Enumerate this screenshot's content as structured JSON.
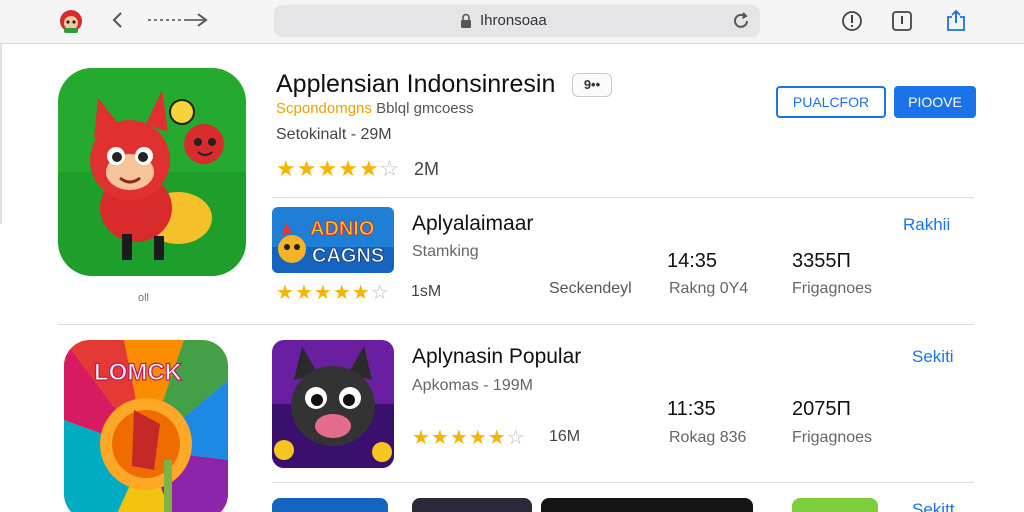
{
  "toolbar": {
    "url": "Ihronsoaa",
    "logo_icon": "mascot-logo-icon",
    "back_icon": "chevron-left-icon",
    "forward_icon": "arrow-right-icon",
    "lock_icon": "lock-icon",
    "reload_icon": "reload-icon",
    "right_icons": [
      "info-icon",
      "bookmark-icon",
      "share-icon"
    ]
  },
  "featured": {
    "title": "Applensian Indonsinresin",
    "more_label": "9••",
    "developer_brand": "Scpondomgns",
    "developer_rest": "Bblql gmcoess",
    "size": "Setokinalt - 29M",
    "rating": 5,
    "rating_count": "2M",
    "icon_caption": "oll",
    "primary_button": "PIOOVE",
    "secondary_button": "PUALCFOR"
  },
  "rows": [
    {
      "title": "Aplyalaimaar",
      "subtitle": "Stamking",
      "rating": 5,
      "rating_count": "1sM",
      "link": "Rakhii",
      "category": "Seckendeyl",
      "stat1_value": "14:35",
      "stat1_label": "Rakng 0Y4",
      "stat2_value": "3355Π",
      "stat2_label": "Frigagnoes",
      "icon_text_top": "ADNIO",
      "icon_text_bottom": "CAGNS"
    },
    {
      "title": "Aplynasin Popular",
      "subtitle": "Apkomas - 199M",
      "rating": 5,
      "rating_count": "16M",
      "link": "Sekiti",
      "stat1_value": "11:35",
      "stat1_label": "Rokag 836",
      "stat2_value": "2075Π",
      "stat2_label": "Frigagnoes"
    },
    {
      "link": "Sekitt"
    }
  ],
  "side_icon": {
    "text": "LOMCK"
  },
  "colors": {
    "accent": "#1a73e8",
    "star": "#f4b400",
    "featured_icon_bg": "#1e9e2b"
  }
}
